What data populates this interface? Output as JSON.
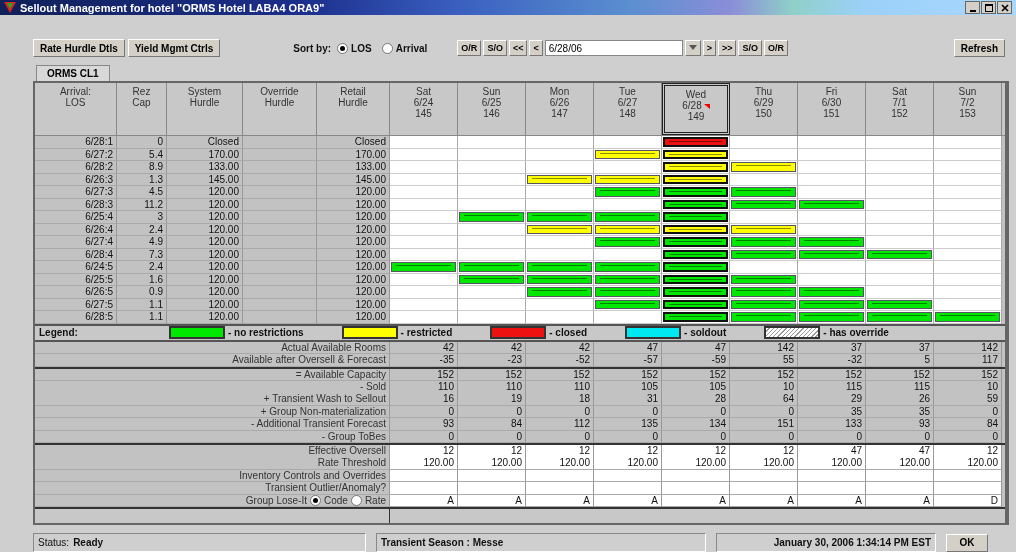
{
  "window": {
    "title": "Sellout Management for hotel \"ORMS Hotel LABA4 ORA9\""
  },
  "toolbar": {
    "buttons": [
      "Rate Hurdle Dtls",
      "Yield Mgmt Ctrls"
    ],
    "sort_label": "Sort by:",
    "sort_options": [
      {
        "label": "LOS",
        "selected": true
      },
      {
        "label": "Arrival",
        "selected": false
      }
    ],
    "left_nav": [
      "O/R",
      "S/O",
      "<<",
      "<"
    ],
    "date": "6/28/06",
    "right_nav": [
      ">",
      ">>",
      "S/O",
      "O/R"
    ],
    "refresh": "Refresh"
  },
  "tabs": [
    {
      "label": "ORMS CL1",
      "selected": true
    }
  ],
  "table": {
    "columns": [
      "Arrival:\nLOS",
      "Rez\nCap",
      "System\nHurdle",
      "Override\nHurdle",
      "Retail\nHurdle"
    ],
    "days": [
      {
        "day": "Sat",
        "date": "6/24",
        "number": "145",
        "selected": false,
        "flagged": false
      },
      {
        "day": "Sun",
        "date": "6/25",
        "number": "146",
        "selected": false,
        "flagged": false
      },
      {
        "day": "Mon",
        "date": "6/26",
        "number": "147",
        "selected": false,
        "flagged": false
      },
      {
        "day": "Tue",
        "date": "6/27",
        "number": "148",
        "selected": false,
        "flagged": false
      },
      {
        "day": "Wed",
        "date": "6/28",
        "number": "149",
        "selected": true,
        "flagged": true
      },
      {
        "day": "Thu",
        "date": "6/29",
        "number": "150",
        "selected": false,
        "flagged": false
      },
      {
        "day": "Fri",
        "date": "6/30",
        "number": "151",
        "selected": false,
        "flagged": false
      },
      {
        "day": "Sat",
        "date": "7/1",
        "number": "152",
        "selected": false,
        "flagged": false
      },
      {
        "day": "Sun",
        "date": "7/2",
        "number": "153",
        "selected": false,
        "flagged": false
      }
    ],
    "rows": [
      {
        "arrival": "6/28:1",
        "cap": "0",
        "system": "Closed",
        "retail": "Closed",
        "cells": [
          {
            "kind": "empty"
          },
          {
            "kind": "empty"
          },
          {
            "kind": "empty"
          },
          {
            "kind": "empty"
          },
          {
            "kind": "closed"
          },
          {
            "kind": "empty"
          },
          {
            "kind": "empty"
          },
          {
            "kind": "empty"
          },
          {
            "kind": "empty"
          }
        ]
      },
      {
        "arrival": "6/27:2",
        "cap": "5.4",
        "system": "170.00",
        "retail": "170.00",
        "cells": [
          {
            "kind": "empty"
          },
          {
            "kind": "empty"
          },
          {
            "kind": "empty"
          },
          {
            "kind": "restricted"
          },
          {
            "kind": "restricted"
          },
          {
            "kind": "empty"
          },
          {
            "kind": "empty"
          },
          {
            "kind": "empty"
          },
          {
            "kind": "empty"
          }
        ]
      },
      {
        "arrival": "6/28:2",
        "cap": "8.9",
        "system": "133.00",
        "retail": "133.00",
        "cells": [
          {
            "kind": "empty"
          },
          {
            "kind": "empty"
          },
          {
            "kind": "empty"
          },
          {
            "kind": "empty"
          },
          {
            "kind": "restricted"
          },
          {
            "kind": "restricted"
          },
          {
            "kind": "empty"
          },
          {
            "kind": "empty"
          },
          {
            "kind": "empty"
          }
        ]
      },
      {
        "arrival": "6/26:3",
        "cap": "1.3",
        "system": "145.00",
        "retail": "145.00",
        "cells": [
          {
            "kind": "empty"
          },
          {
            "kind": "empty"
          },
          {
            "kind": "restricted"
          },
          {
            "kind": "restricted"
          },
          {
            "kind": "restricted"
          },
          {
            "kind": "empty"
          },
          {
            "kind": "empty"
          },
          {
            "kind": "empty"
          },
          {
            "kind": "empty"
          }
        ]
      },
      {
        "arrival": "6/27:3",
        "cap": "4.5",
        "system": "120.00",
        "retail": "120.00",
        "cells": [
          {
            "kind": "empty"
          },
          {
            "kind": "empty"
          },
          {
            "kind": "empty"
          },
          {
            "kind": "open"
          },
          {
            "kind": "open"
          },
          {
            "kind": "open"
          },
          {
            "kind": "empty"
          },
          {
            "kind": "empty"
          },
          {
            "kind": "empty"
          }
        ]
      },
      {
        "arrival": "6/28:3",
        "cap": "11.2",
        "system": "120.00",
        "retail": "120.00",
        "cells": [
          {
            "kind": "empty"
          },
          {
            "kind": "empty"
          },
          {
            "kind": "empty"
          },
          {
            "kind": "empty"
          },
          {
            "kind": "open"
          },
          {
            "kind": "open"
          },
          {
            "kind": "open"
          },
          {
            "kind": "empty"
          },
          {
            "kind": "empty"
          }
        ]
      },
      {
        "arrival": "6/25:4",
        "cap": "3",
        "system": "120.00",
        "retail": "120.00",
        "cells": [
          {
            "kind": "empty"
          },
          {
            "kind": "open"
          },
          {
            "kind": "open"
          },
          {
            "kind": "open"
          },
          {
            "kind": "open"
          },
          {
            "kind": "empty"
          },
          {
            "kind": "empty"
          },
          {
            "kind": "empty"
          },
          {
            "kind": "empty"
          }
        ]
      },
      {
        "arrival": "6/26:4",
        "cap": "2.4",
        "system": "120.00",
        "retail": "120.00",
        "cells": [
          {
            "kind": "empty"
          },
          {
            "kind": "empty"
          },
          {
            "kind": "restricted"
          },
          {
            "kind": "restricted"
          },
          {
            "kind": "restricted"
          },
          {
            "kind": "restricted"
          },
          {
            "kind": "empty"
          },
          {
            "kind": "empty"
          },
          {
            "kind": "empty"
          }
        ]
      },
      {
        "arrival": "6/27:4",
        "cap": "4.9",
        "system": "120.00",
        "retail": "120.00",
        "cells": [
          {
            "kind": "empty"
          },
          {
            "kind": "empty"
          },
          {
            "kind": "empty"
          },
          {
            "kind": "open"
          },
          {
            "kind": "open"
          },
          {
            "kind": "open"
          },
          {
            "kind": "open"
          },
          {
            "kind": "empty"
          },
          {
            "kind": "empty"
          }
        ]
      },
      {
        "arrival": "6/28:4",
        "cap": "7.3",
        "system": "120.00",
        "retail": "120.00",
        "cells": [
          {
            "kind": "empty"
          },
          {
            "kind": "empty"
          },
          {
            "kind": "empty"
          },
          {
            "kind": "empty"
          },
          {
            "kind": "open"
          },
          {
            "kind": "open"
          },
          {
            "kind": "open"
          },
          {
            "kind": "open"
          },
          {
            "kind": "empty"
          }
        ]
      },
      {
        "arrival": "6/24:5",
        "cap": "2.4",
        "system": "120.00",
        "retail": "120.00",
        "cells": [
          {
            "kind": "open"
          },
          {
            "kind": "open"
          },
          {
            "kind": "open"
          },
          {
            "kind": "open"
          },
          {
            "kind": "open"
          },
          {
            "kind": "empty"
          },
          {
            "kind": "empty"
          },
          {
            "kind": "empty"
          },
          {
            "kind": "empty"
          }
        ]
      },
      {
        "arrival": "6/25:5",
        "cap": "1.6",
        "system": "120.00",
        "retail": "120.00",
        "cells": [
          {
            "kind": "empty"
          },
          {
            "kind": "open"
          },
          {
            "kind": "open"
          },
          {
            "kind": "open"
          },
          {
            "kind": "open"
          },
          {
            "kind": "open"
          },
          {
            "kind": "empty"
          },
          {
            "kind": "empty"
          },
          {
            "kind": "empty"
          }
        ]
      },
      {
        "arrival": "6/26:5",
        "cap": "0.9",
        "system": "120.00",
        "retail": "120.00",
        "cells": [
          {
            "kind": "empty"
          },
          {
            "kind": "empty"
          },
          {
            "kind": "open"
          },
          {
            "kind": "open"
          },
          {
            "kind": "open"
          },
          {
            "kind": "open"
          },
          {
            "kind": "open"
          },
          {
            "kind": "empty"
          },
          {
            "kind": "empty"
          }
        ]
      },
      {
        "arrival": "6/27:5",
        "cap": "1.1",
        "system": "120.00",
        "retail": "120.00",
        "cells": [
          {
            "kind": "empty"
          },
          {
            "kind": "empty"
          },
          {
            "kind": "empty"
          },
          {
            "kind": "open"
          },
          {
            "kind": "open"
          },
          {
            "kind": "open"
          },
          {
            "kind": "open"
          },
          {
            "kind": "open"
          },
          {
            "kind": "empty"
          }
        ]
      },
      {
        "arrival": "6/28:5",
        "cap": "1.1",
        "system": "120.00",
        "retail": "120.00",
        "cells": [
          {
            "kind": "empty"
          },
          {
            "kind": "empty"
          },
          {
            "kind": "empty"
          },
          {
            "kind": "empty"
          },
          {
            "kind": "open"
          },
          {
            "kind": "open"
          },
          {
            "kind": "open"
          },
          {
            "kind": "open"
          },
          {
            "kind": "open"
          }
        ]
      }
    ]
  },
  "legend": {
    "title": "Legend:",
    "items": [
      {
        "kind": "open",
        "label": "- no restrictions"
      },
      {
        "kind": "restricted",
        "label": "- restricted"
      },
      {
        "kind": "closed",
        "label": "- closed"
      },
      {
        "kind": "soldout",
        "label": "- soldout"
      },
      {
        "kind": "override",
        "label": "- has override"
      }
    ]
  },
  "summary": [
    {
      "kind": "gray",
      "label": "Actual Available Rooms",
      "values": [
        "42",
        "42",
        "42",
        "47",
        "47",
        "142",
        "37",
        "37",
        "142"
      ]
    },
    {
      "kind": "gray",
      "label": "Available after Oversell & Forecast",
      "values": [
        "-35",
        "-23",
        "-52",
        "-57",
        "-59",
        "55",
        "-32",
        "5",
        "117"
      ]
    },
    {
      "kind": "gray",
      "label": "= Available Capacity",
      "values": [
        "152",
        "152",
        "152",
        "152",
        "152",
        "152",
        "152",
        "152",
        "152"
      ]
    },
    {
      "kind": "gray",
      "label": "- Sold",
      "values": [
        "110",
        "110",
        "110",
        "105",
        "105",
        "10",
        "115",
        "115",
        "10"
      ]
    },
    {
      "kind": "gray",
      "label": "+ Transient Wash to Sellout",
      "values": [
        "16",
        "19",
        "18",
        "31",
        "28",
        "64",
        "29",
        "26",
        "59"
      ]
    },
    {
      "kind": "gray",
      "label": "+ Group Non-materialization",
      "values": [
        "0",
        "0",
        "0",
        "0",
        "0",
        "0",
        "35",
        "35",
        "0"
      ]
    },
    {
      "kind": "gray",
      "label": "- Additional Transient Forecast",
      "values": [
        "93",
        "84",
        "112",
        "135",
        "134",
        "151",
        "133",
        "93",
        "84"
      ]
    },
    {
      "kind": "gray",
      "label": "- Group ToBes",
      "values": [
        "0",
        "0",
        "0",
        "0",
        "0",
        "0",
        "0",
        "0",
        "0"
      ]
    },
    {
      "kind": "white",
      "label": "Effective Oversell",
      "values": [
        "12",
        "12",
        "12",
        "12",
        "12",
        "12",
        "47",
        "47",
        "12"
      ]
    },
    {
      "kind": "white",
      "label": "Rate Threshold",
      "values": [
        "120.00",
        "120.00",
        "120.00",
        "120.00",
        "120.00",
        "120.00",
        "120.00",
        "120.00",
        "120.00"
      ]
    },
    {
      "kind": "white",
      "label": "Inventory Controls and Overrides"
    },
    {
      "kind": "white",
      "label": "Transient Outlier/Anomaly?"
    },
    {
      "kind": "radio",
      "label": "Group Lose-It",
      "options": [
        {
          "label": "Code",
          "selected": true
        },
        {
          "label": "Rate",
          "selected": false
        }
      ],
      "values": [
        "A",
        "A",
        "A",
        "A",
        "A",
        "A",
        "A",
        "A",
        "D"
      ]
    }
  ],
  "status_bar": {
    "label": "Status:",
    "value": "Ready",
    "season": "Transient Season : Messe",
    "datetime": "January 30, 2006 1:34:14 PM EST",
    "button": "OK"
  }
}
